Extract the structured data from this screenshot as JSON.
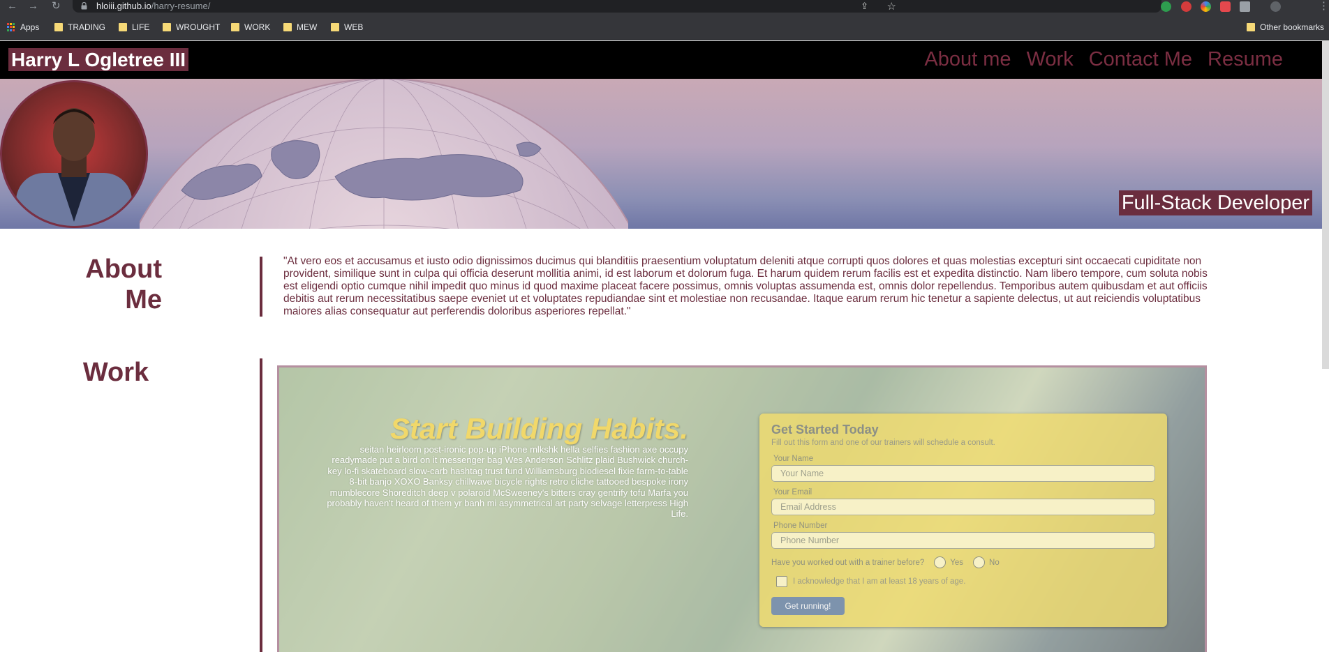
{
  "browser": {
    "url_host": "hloiii.github.io",
    "url_path": "/harry-resume/",
    "bookmarks": [
      "Apps",
      "TRADING",
      "LIFE",
      "WROUGHT",
      "WORK",
      "MEW",
      "WEB"
    ],
    "other_bookmarks": "Other bookmarks",
    "icons": [
      "back-icon",
      "forward-icon",
      "reload-icon",
      "lock-icon",
      "share-icon",
      "star-icon",
      "extensions-icon",
      "menu-icon"
    ]
  },
  "site": {
    "name": "Harry L Ogletree III",
    "nav": [
      "About me",
      "Work",
      "Contact Me",
      "Resume"
    ],
    "tagline": "Full-Stack Developer",
    "accent": "#6b2d3e"
  },
  "about": {
    "heading_1": "About",
    "heading_2": "Me",
    "text": "\"At vero eos et accusamus et iusto odio dignissimos ducimus qui blanditiis praesentium voluptatum deleniti atque corrupti quos dolores et quas molestias excepturi sint occaecati cupiditate non provident, similique sunt in culpa qui officia deserunt mollitia animi, id est laborum et dolorum fuga. Et harum quidem rerum facilis est et expedita distinctio. Nam libero tempore, cum soluta nobis est eligendi optio cumque nihil impedit quo minus id quod maxime placeat facere possimus, omnis voluptas assumenda est, omnis dolor repellendus. Temporibus autem quibusdam et aut officiis debitis aut rerum necessitatibus saepe eveniet ut et voluptates repudiandae sint et molestiae non recusandae. Itaque earum rerum hic tenetur a sapiente delectus, ut aut reiciendis voluptatibus maiores alias consequatur aut perferendis doloribus asperiores repellat.\""
  },
  "work": {
    "heading": "Work",
    "project": {
      "title": "Start Building Habits.",
      "description": "seitan heirloom post-ironic pop-up iPhone mlkshk hella selfies fashion axe occupy readymade put a bird on it messenger bag Wes Anderson Schlitz plaid Bushwick church-key lo-fi skateboard slow-carb hashtag trust fund Williamsburg biodiesel fixie farm-to-table 8-bit banjo XOXO Banksy chillwave bicycle rights retro cliche tattooed bespoke irony mumblecore Shoreditch deep v polaroid McSweeney's bitters cray gentrify tofu Marfa you probably haven't heard of them yr banh mi asymmetrical art party selvage letterpress High Life.",
      "form": {
        "title": "Get Started Today",
        "subtitle": "Fill out this form and one of our trainers will schedule a consult.",
        "name_label": "Your Name",
        "name_placeholder": "Your Name",
        "email_label": "Your Email",
        "email_placeholder": "Email Address",
        "phone_label": "Phone Number",
        "phone_placeholder": "Phone Number",
        "question": "Have you worked out with a trainer before?",
        "yes": "Yes",
        "no": "No",
        "acknowledge": "I acknowledge that I am at least 18 years of age.",
        "submit": "Get running!"
      }
    }
  }
}
